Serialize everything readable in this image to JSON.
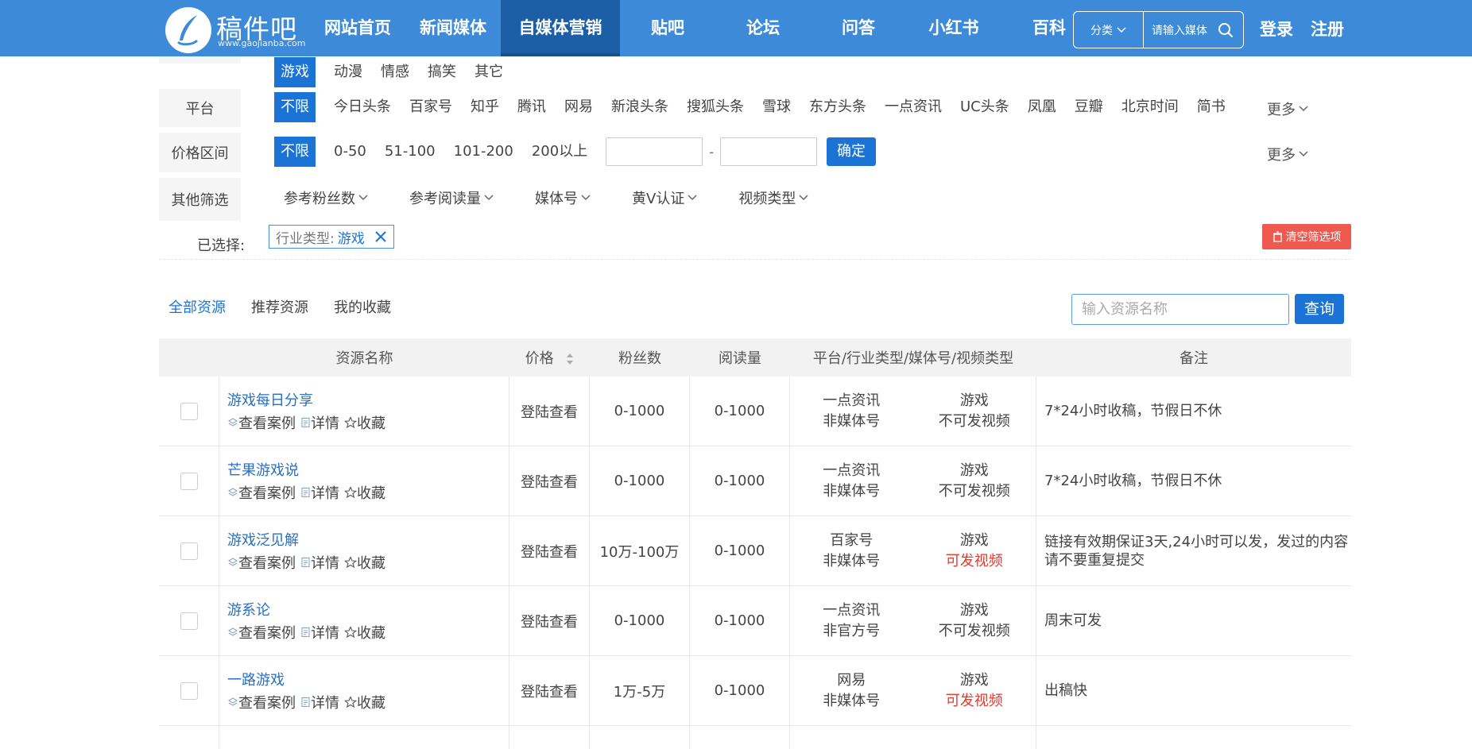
{
  "header": {
    "logo_name": "稿件吧",
    "logo_url": "www.gaojianba.com",
    "nav": [
      "网站首页",
      "新闻媒体",
      "自媒体营销",
      "贴吧",
      "论坛",
      "问答",
      "小红书",
      "百科"
    ],
    "search_category": "分类",
    "search_placeholder": "请输入媒体",
    "login": "登录",
    "register": "注册"
  },
  "filters": {
    "industry_options": [
      "游戏",
      "动漫",
      "情感",
      "搞笑",
      "其它"
    ],
    "platform_label": "平台",
    "platform_options": [
      "不限",
      "今日头条",
      "百家号",
      "知乎",
      "腾讯",
      "网易",
      "新浪头条",
      "搜狐头条",
      "雪球",
      "东方头条",
      "一点资讯",
      "UC头条",
      "凤凰",
      "豆瓣",
      "北京时间",
      "简书"
    ],
    "more": "更多",
    "price_label": "价格区间",
    "price_options": [
      "不限",
      "0-50",
      "51-100",
      "101-200",
      "200以上"
    ],
    "price_dash": "-",
    "confirm": "确定",
    "other_label": "其他筛选",
    "other_dropdowns": [
      "参考粉丝数",
      "参考阅读量",
      "媒体号",
      "黄V认证",
      "视频类型"
    ],
    "selected_label": "已选择:",
    "chip_key": "行业类型:",
    "chip_value": "游戏",
    "clear": "清空筛选项"
  },
  "tabs": [
    "全部资源",
    "推荐资源",
    "我的收藏"
  ],
  "resource_search_placeholder": "输入资源名称",
  "query": "查询",
  "table": {
    "headers": [
      "资源名称",
      "价格",
      "粉丝数",
      "阅读量",
      "平台/行业类型/媒体号/视频类型",
      "备注"
    ],
    "action_case": "查看案例",
    "action_detail": "详情",
    "action_fav": "收藏",
    "rows": [
      {
        "name": "游戏每日分享",
        "price": "登陆查看",
        "fans": "0-1000",
        "reads": "0-1000",
        "platform": "一点资讯",
        "media": "非媒体号",
        "industry": "游戏",
        "video": "不可发视频",
        "video_ok": false,
        "note": "7*24小时收稿，节假日不休"
      },
      {
        "name": "芒果游戏说",
        "price": "登陆查看",
        "fans": "0-1000",
        "reads": "0-1000",
        "platform": "一点资讯",
        "media": "非媒体号",
        "industry": "游戏",
        "video": "不可发视频",
        "video_ok": false,
        "note": "7*24小时收稿，节假日不休"
      },
      {
        "name": "游戏泛见解",
        "price": "登陆查看",
        "fans": "10万-100万",
        "reads": "0-1000",
        "platform": "百家号",
        "media": "非媒体号",
        "industry": "游戏",
        "video": "可发视频",
        "video_ok": true,
        "note": "链接有效期保证3天,24小时可以发，发过的内容请不要重复提交"
      },
      {
        "name": "游系论",
        "price": "登陆查看",
        "fans": "0-1000",
        "reads": "0-1000",
        "platform": "一点资讯",
        "media": "非官方号",
        "industry": "游戏",
        "video": "不可发视频",
        "video_ok": false,
        "note": "周末可发"
      },
      {
        "name": "一路游戏",
        "price": "登陆查看",
        "fans": "1万-5万",
        "reads": "0-1000",
        "platform": "网易",
        "media": "非媒体号",
        "industry": "游戏",
        "video": "可发视频",
        "video_ok": true,
        "note": "出稿快"
      }
    ]
  }
}
